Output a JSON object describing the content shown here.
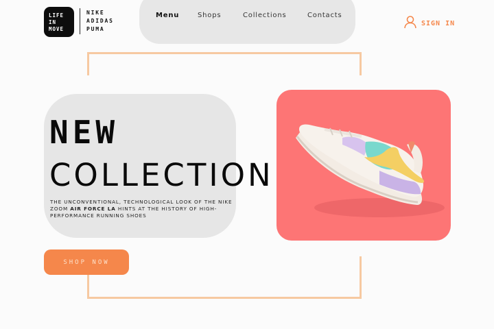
{
  "logo": {
    "lines": [
      "LIFE",
      "IN",
      "MOVE"
    ]
  },
  "brands": [
    "NIKE",
    "ADIDAS",
    "PUMA"
  ],
  "nav": {
    "items": [
      "Menu",
      "Shops",
      "Collections",
      "Contacts"
    ],
    "active": "Menu"
  },
  "signin": {
    "label": "SIGN IN",
    "icon": "user-icon"
  },
  "hero": {
    "title_line1": "NEW",
    "title_line2": "COLLECTION",
    "desc_before": "THE UNCONVENTIONAL, TECHNOLOGICAL LOOK OF THE NIKE ZOOM ",
    "desc_bold": "AIR FORCE LA",
    "desc_after": " HINTS AT THE HISTORY OF HIGH-PERFORMANCE RUNNING SHOES"
  },
  "cta": {
    "label": "SHOP NOW"
  },
  "colors": {
    "accent": "#f5874b",
    "product_bg": "#fd7575",
    "frame": "#f6c9a1",
    "card": "#e6e6e6"
  }
}
